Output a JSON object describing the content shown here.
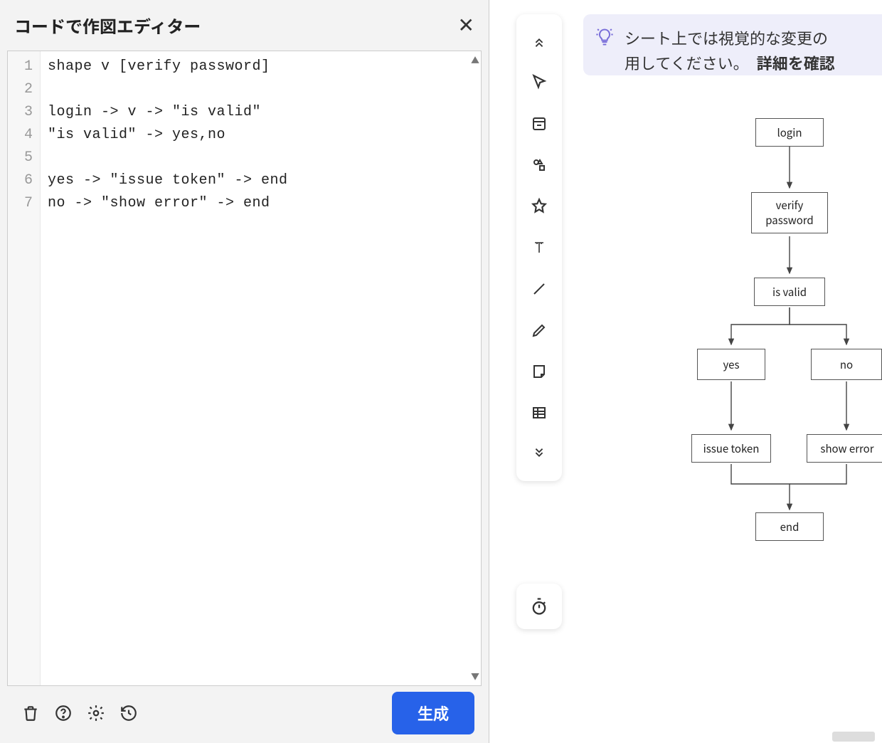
{
  "editor": {
    "title": "コードで作図エディター",
    "line_numbers": [
      "1",
      "2",
      "3",
      "4",
      "5",
      "6",
      "7"
    ],
    "code": "shape v [verify password]\n\nlogin -> v -> \"is valid\"\n\"is valid\" -> yes,no\n\nyes -> \"issue token\" -> end\nno -> \"show error\" -> end",
    "generate_label": "生成"
  },
  "bottom_icons": [
    "trash-icon",
    "help-icon",
    "gear-icon",
    "history-icon"
  ],
  "floating_tools": [
    "collapse-icon",
    "cursor-icon",
    "panel-icon",
    "shapes-icon",
    "star-icon",
    "text-icon",
    "line-icon",
    "pencil-icon",
    "note-icon",
    "table-icon",
    "expand-icon"
  ],
  "timer_icon": "stopwatch-icon",
  "hint": {
    "text": "シート上では視覚的な変更の",
    "text2": "用してください。　",
    "link": "詳細を確認"
  },
  "diagram": {
    "nodes": {
      "login": "login",
      "verify": "verify password",
      "isvalid": "is valid",
      "yes": "yes",
      "no": "no",
      "issue": "issue token",
      "showerr": "show error",
      "end": "end"
    }
  }
}
